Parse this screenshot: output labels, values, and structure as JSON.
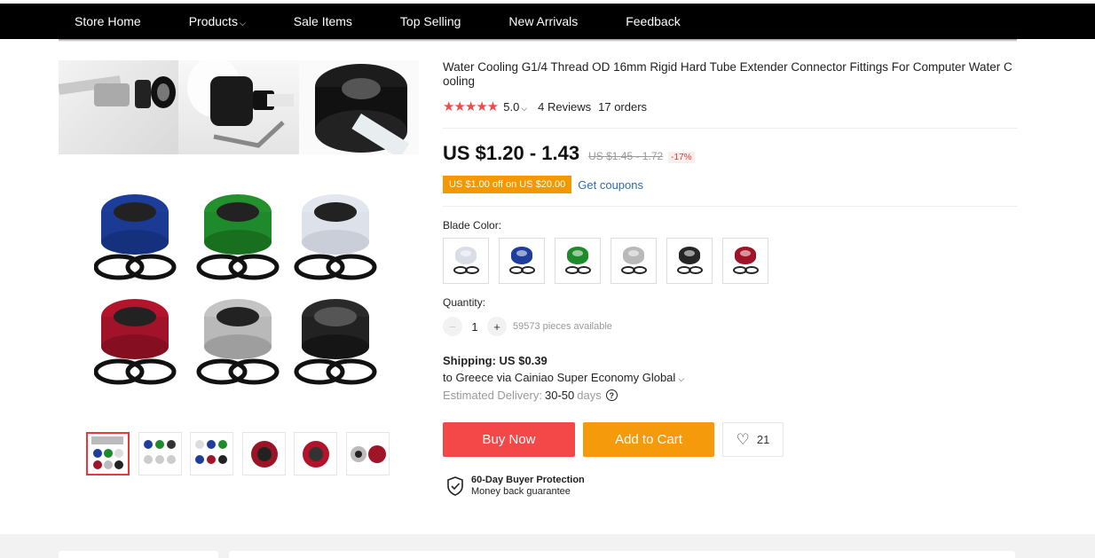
{
  "nav": {
    "items": [
      "Store Home",
      "Products",
      "Sale Items",
      "Top Selling",
      "New Arrivals",
      "Feedback"
    ],
    "products_caret": "⌵"
  },
  "product": {
    "title": "Water Cooling G1/4 Thread OD 16mm Rigid Hard Tube Extender Connector Fittings For Computer Water Cooling",
    "stars": "★★★★★",
    "rating": "5.0",
    "rating_caret": "⌵",
    "reviews": "4 Reviews",
    "orders": "17 orders",
    "price": "US $1.20 - 1.43",
    "price_original": "US $1.45 - 1.72",
    "discount": "-17%",
    "coupon_badge": "US $1.00 off on US $20.00",
    "coupon_link": "Get coupons"
  },
  "variants": {
    "label": "Blade Color:",
    "colors": [
      {
        "name": "silver-white",
        "hex": "#d8dde6"
      },
      {
        "name": "blue",
        "hex": "#1f3d9c"
      },
      {
        "name": "green",
        "hex": "#1f8a2b"
      },
      {
        "name": "silver",
        "hex": "#b9b9b9"
      },
      {
        "name": "black",
        "hex": "#262626"
      },
      {
        "name": "red",
        "hex": "#a01328"
      }
    ]
  },
  "quantity": {
    "label": "Quantity:",
    "minus": "−",
    "plus": "+",
    "value": "1",
    "available": "59573 pieces available"
  },
  "shipping": {
    "title": "Shipping: US $0.39",
    "to": "to Greece via Cainiao Super Economy Global",
    "to_caret": "⌵",
    "est_label": "Estimated Delivery:",
    "est_value": "30-50",
    "est_unit": "days",
    "help": "?"
  },
  "actions": {
    "buy_now": "Buy Now",
    "add_to_cart": "Add to Cart",
    "wishlist_count": "21"
  },
  "protection": {
    "title": "60-Day Buyer Protection",
    "subtitle": "Money back guarantee"
  },
  "colors": {
    "buy": "#f44747",
    "cart": "#f59a0a",
    "coupon": "#f39800",
    "star": "#f04a4a"
  }
}
